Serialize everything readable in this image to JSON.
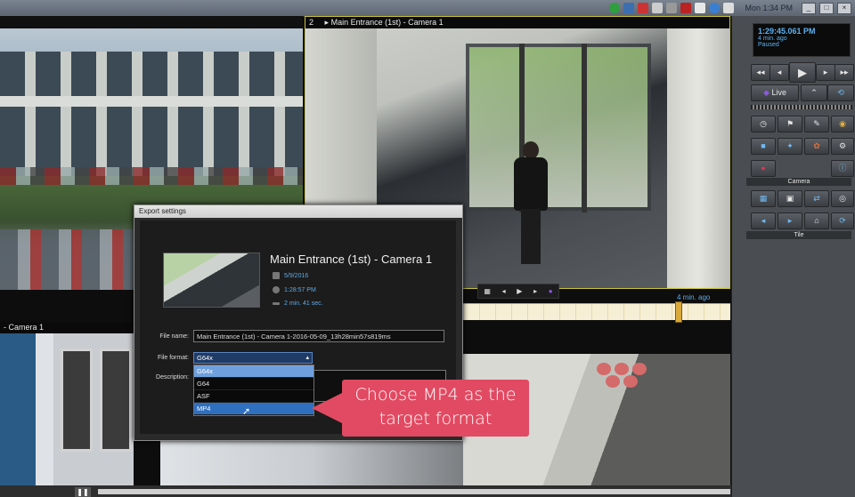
{
  "taskbar": {
    "clock": "Mon 1:34 PM",
    "window_buttons": [
      "_",
      "□",
      "×"
    ]
  },
  "tiles": {
    "tile2_title": "Main Entrance (1st) - Camera 1",
    "tile2_index": "2",
    "tile2_ago": "4 min. ago",
    "tile3_title": "- Camera 1"
  },
  "playback_panel": {
    "time": "1:29:45.061 PM",
    "ago": "4 min. ago",
    "status": "Paused",
    "live_label": "Live",
    "camera_section": "Camera",
    "tile_section": "Tile"
  },
  "export_dialog": {
    "title": "Export settings",
    "camera_name": "Main Entrance (1st) - Camera 1",
    "date": "5/9/2016",
    "time": "1:28:57 PM",
    "duration": "2 min. 41 sec.",
    "file_name_label": "File name:",
    "file_name_value": "Main Entrance (1st) - Camera 1-2016-05-09_13h28min57s819ms",
    "file_format_label": "File format:",
    "file_format_value": "G64x",
    "description_label": "Description:",
    "format_options": [
      "G64x",
      "G64",
      "ASF",
      "MP4"
    ],
    "selected_option": "G64x",
    "hovered_option": "MP4"
  },
  "callout": {
    "line1": "Choose MP4 as the",
    "line2": "target format",
    "color": "#e14a62"
  },
  "colors": {
    "accent_blue": "#5fa9e6",
    "tile_highlight": "#c8c23a"
  }
}
